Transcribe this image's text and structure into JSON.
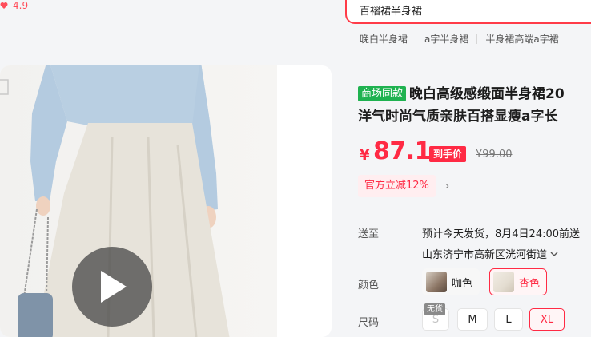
{
  "rating": {
    "score": "4.9",
    "icon": "heart-icon"
  },
  "search": {
    "value": "百褶裙半身裙"
  },
  "hot_searches": [
    "晚白半身裙",
    "a字半身裙",
    "半身裙高端a字裙"
  ],
  "gallery": {
    "play_icon": "play-icon"
  },
  "product": {
    "badge": "商场同款",
    "title_line1": "晚白高级感缎面半身裙20",
    "title_line2": "洋气时尚气质亲肤百搭显瘦a字长"
  },
  "price": {
    "currency": "¥",
    "value": "87.1",
    "tag": "到手价",
    "original": "¥99.00"
  },
  "promo": {
    "text": "官方立减12%",
    "arrow": "›"
  },
  "delivery": {
    "label": "送至",
    "shipping": "预计今天发货，8月4日24:00前送",
    "address": "山东济宁市高新区洸河街道"
  },
  "color": {
    "label": "颜色",
    "options": [
      {
        "name": "咖色",
        "selected": false
      },
      {
        "name": "杏色",
        "selected": true
      }
    ]
  },
  "size": {
    "label": "尺码",
    "no_stock_tag": "无货",
    "options": [
      {
        "name": "S",
        "state": "disabled"
      },
      {
        "name": "M",
        "state": "normal"
      },
      {
        "name": "L",
        "state": "normal"
      },
      {
        "name": "XL",
        "state": "selected"
      }
    ]
  },
  "colors": {
    "accent": "#ff2a44",
    "badge_green": "#1fb250",
    "search_border": "#ff3b48"
  }
}
